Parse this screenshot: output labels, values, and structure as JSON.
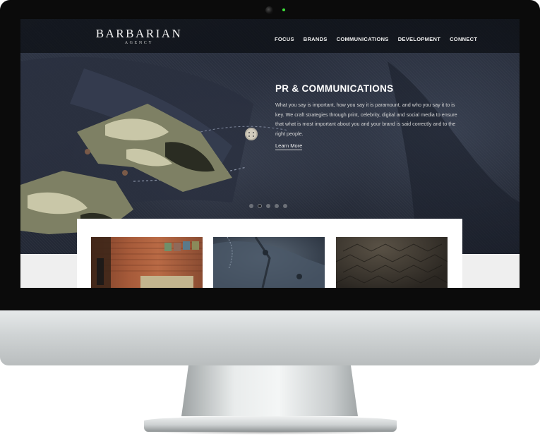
{
  "site": {
    "logo_main": "BARBARIAN",
    "logo_sub": "AGENCY"
  },
  "nav": {
    "items": [
      "FOCUS",
      "BRANDS",
      "COMMUNICATIONS",
      "DEVELOPMENT",
      "CONNECT"
    ]
  },
  "hero": {
    "title": "PR & COMMUNICATIONS",
    "body": "What you say is important, how you say it is paramount, and who you say it to is key. We craft strategies through print, celebrity, digital and social media to ensure that what is most important about you and your brand is said correctly and to the right people.",
    "link": "Learn More"
  },
  "carousel": {
    "count": 5,
    "active_index": 1
  },
  "colors": {
    "bezel": "#0b0b0b",
    "hero_dark": "#262c3a",
    "camo_light": "#c9c7a8",
    "camo_mid": "#7e8064",
    "camo_dark": "#2a2c22",
    "camera_led": "#3ee03a"
  }
}
